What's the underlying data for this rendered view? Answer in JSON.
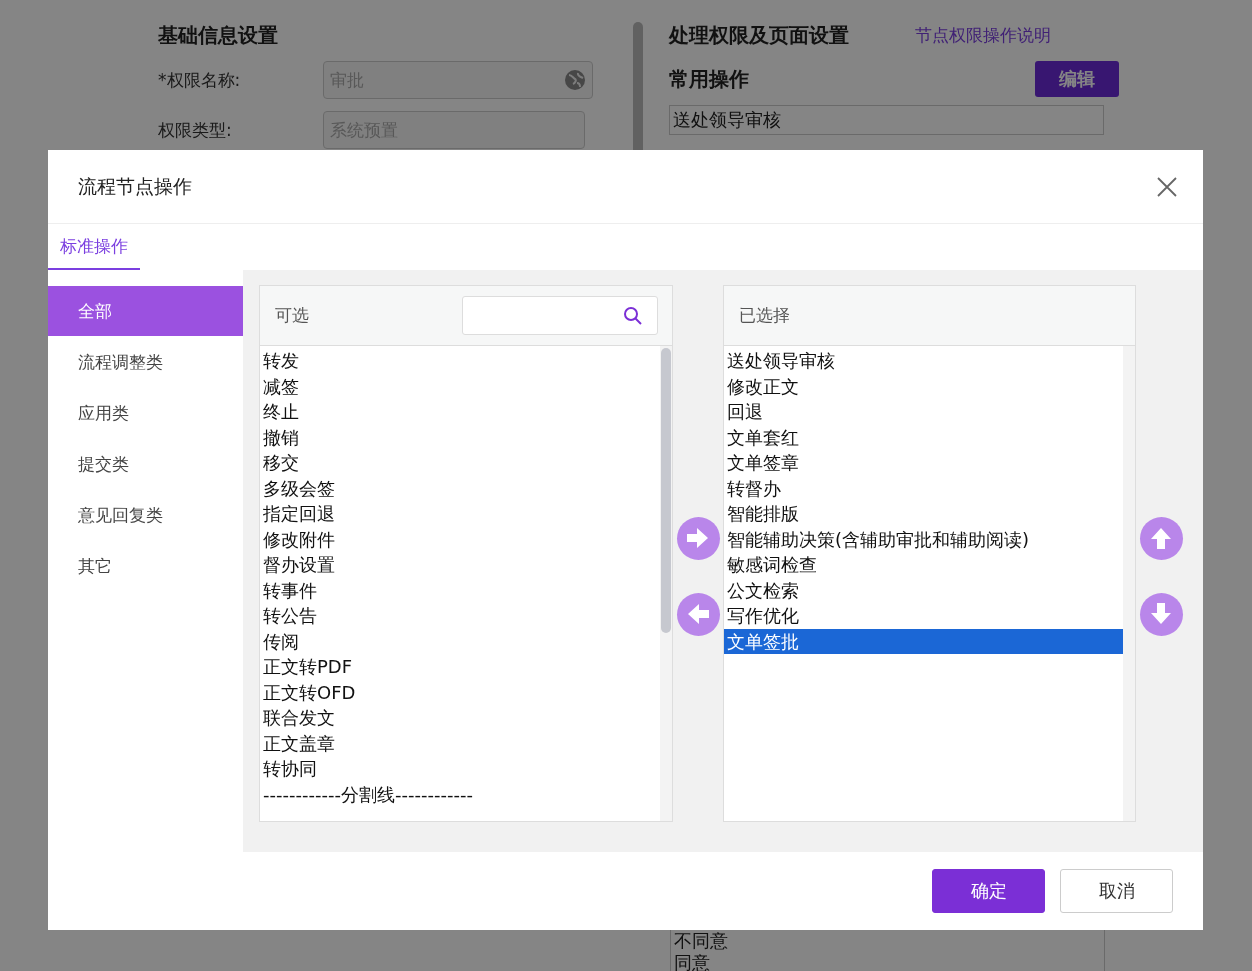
{
  "page": {
    "basic_title": "基础信息设置",
    "fields": [
      {
        "label": "*权限名称:",
        "value": "审批",
        "globe": true
      },
      {
        "label": "权限类型:",
        "value": "系统预置",
        "globe": false
      }
    ],
    "perm_title": "处理权限及页面设置",
    "help_link": "节点权限操作说明",
    "common_title": "常用操作",
    "edit_button": "编辑",
    "common_list": [
      "送处领导审核"
    ],
    "bottom_list": [
      "不同意",
      "同意"
    ]
  },
  "dialog": {
    "title": "流程节点操作",
    "tabs": [
      {
        "label": "标准操作",
        "selected": true
      }
    ],
    "categories": [
      {
        "label": "全部",
        "selected": true
      },
      {
        "label": "流程调整类",
        "selected": false
      },
      {
        "label": "应用类",
        "selected": false
      },
      {
        "label": "提交类",
        "selected": false
      },
      {
        "label": "意见回复类",
        "selected": false
      },
      {
        "label": "其它",
        "selected": false
      }
    ],
    "available": {
      "title": "可选",
      "items": [
        "转发",
        "减签",
        "终止",
        "撤销",
        "移交",
        "多级会签",
        "指定回退",
        "修改附件",
        "督办设置",
        "转事件",
        "转公告",
        "传阅",
        "正文转PDF",
        "正文转OFD",
        "联合发文",
        "正文盖章",
        "转协同",
        "------------分割线------------"
      ]
    },
    "chosen": {
      "title": "已选择",
      "items": [
        {
          "label": "送处领导审核",
          "selected": false
        },
        {
          "label": "修改正文",
          "selected": false
        },
        {
          "label": "回退",
          "selected": false
        },
        {
          "label": "文单套红",
          "selected": false
        },
        {
          "label": "文单签章",
          "selected": false
        },
        {
          "label": "转督办",
          "selected": false
        },
        {
          "label": "智能排版",
          "selected": false
        },
        {
          "label": "智能辅助决策(含辅助审批和辅助阅读)",
          "selected": false
        },
        {
          "label": "敏感词检查",
          "selected": false
        },
        {
          "label": "公文检索",
          "selected": false
        },
        {
          "label": "写作优化",
          "selected": false
        },
        {
          "label": "文单签批",
          "selected": true
        }
      ]
    },
    "buttons": [
      {
        "label": "确定",
        "kind": "primary"
      },
      {
        "label": "取消",
        "kind": "default"
      }
    ]
  }
}
